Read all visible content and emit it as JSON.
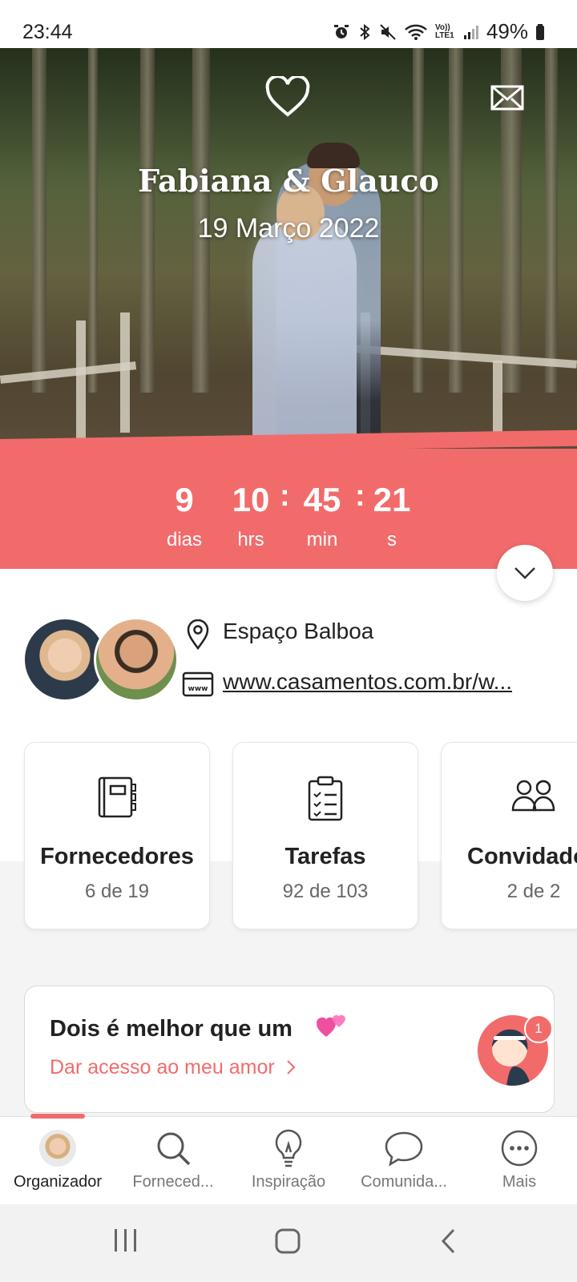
{
  "status_bar": {
    "time": "23:44",
    "battery": "49%",
    "icons": [
      "alarm-icon",
      "bluetooth-icon",
      "mute-icon",
      "wifi-icon",
      "volte-icon",
      "signal-icon",
      "battery-icon"
    ],
    "volte_label": "Vo)) LTE1"
  },
  "hero": {
    "couple_names": "Fabiana & Glauco",
    "date": "19 Março 2022",
    "icons": [
      "heart-icon",
      "mail-icon"
    ]
  },
  "countdown": {
    "days": "9",
    "days_label": "dias",
    "hours": "10",
    "hours_label": "hrs",
    "minutes": "45",
    "minutes_label": "min",
    "seconds": "21",
    "seconds_label": "s",
    "separator": ":"
  },
  "info": {
    "venue": "Espaço Balboa",
    "website": "www.casamentos.com.br/w..."
  },
  "cards": [
    {
      "title": "Fornecedores",
      "count": "6 de 19",
      "icon": "notebook-icon"
    },
    {
      "title": "Tarefas",
      "count": "92 de 103",
      "icon": "checklist-icon"
    },
    {
      "title": "Convidados",
      "count": "2 de 2",
      "icon": "guests-icon"
    }
  ],
  "promo": {
    "title": "Dois é melhor que um",
    "link": "Dar acesso ao meu amor",
    "badge": "1"
  },
  "nav": {
    "items": [
      {
        "label": "Organizador",
        "icon": "avatar"
      },
      {
        "label": "Forneced...",
        "icon": "search-icon"
      },
      {
        "label": "Inspiração",
        "icon": "lightbulb-icon"
      },
      {
        "label": "Comunida...",
        "icon": "chat-icon"
      },
      {
        "label": "Mais",
        "icon": "more-icon"
      }
    ],
    "active": "Organizador"
  },
  "colors": {
    "accent": "#f26b6b",
    "text": "#222222",
    "muted": "#666666"
  }
}
